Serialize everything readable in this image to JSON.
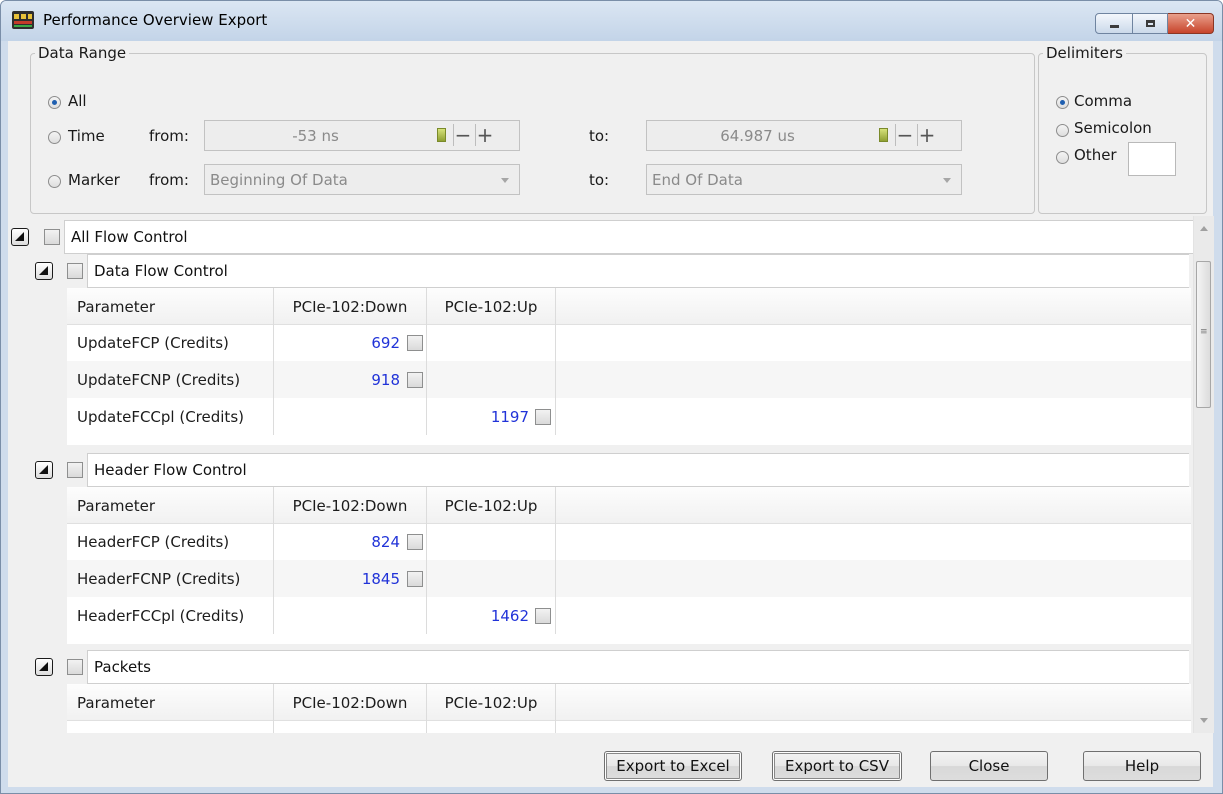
{
  "window": {
    "title": "Performance Overview Export",
    "minimize_icon": "minimize-icon",
    "maximize_icon": "maximize-icon",
    "close_icon": "close-icon"
  },
  "data_range": {
    "legend": "Data Range",
    "all_label": "All",
    "time_label": "Time",
    "marker_label": "Marker",
    "from_label": "from:",
    "to_label": "to:",
    "time_from_value": "-53 ns",
    "time_to_value": "64.987 us",
    "marker_from_value": "Beginning Of Data",
    "marker_to_value": "End Of Data",
    "selected": "All"
  },
  "delimiters": {
    "legend": "Delimiters",
    "comma_label": "Comma",
    "semicolon_label": "Semicolon",
    "other_label": "Other",
    "other_value": "",
    "selected": "Comma"
  },
  "tree": {
    "root_label": "All Flow Control",
    "sections": [
      {
        "title": "Data Flow Control",
        "columns": [
          "Parameter",
          "PCIe-102:Down",
          "PCIe-102:Up"
        ],
        "rows": [
          {
            "param": "UpdateFCP (Credits)",
            "down": "692",
            "up": ""
          },
          {
            "param": "UpdateFCNP (Credits)",
            "down": "918",
            "up": ""
          },
          {
            "param": "UpdateFCCpl (Credits)",
            "down": "",
            "up": "1197"
          }
        ]
      },
      {
        "title": "Header Flow Control",
        "columns": [
          "Parameter",
          "PCIe-102:Down",
          "PCIe-102:Up"
        ],
        "rows": [
          {
            "param": "HeaderFCP (Credits)",
            "down": "824",
            "up": ""
          },
          {
            "param": "HeaderFCNP (Credits)",
            "down": "1845",
            "up": ""
          },
          {
            "param": "HeaderFCCpl (Credits)",
            "down": "",
            "up": "1462"
          }
        ]
      },
      {
        "title": "Packets",
        "columns": [
          "Parameter",
          "PCIe-102:Down",
          "PCIe-102:Up"
        ],
        "rows": []
      }
    ]
  },
  "buttons": {
    "export_excel": "Export to Excel",
    "export_csv": "Export to CSV",
    "close": "Close",
    "help": "Help"
  },
  "colors": {
    "value_text": "#2133d8",
    "title_bar": "#c9d8ea",
    "close_button": "#c7442b"
  }
}
